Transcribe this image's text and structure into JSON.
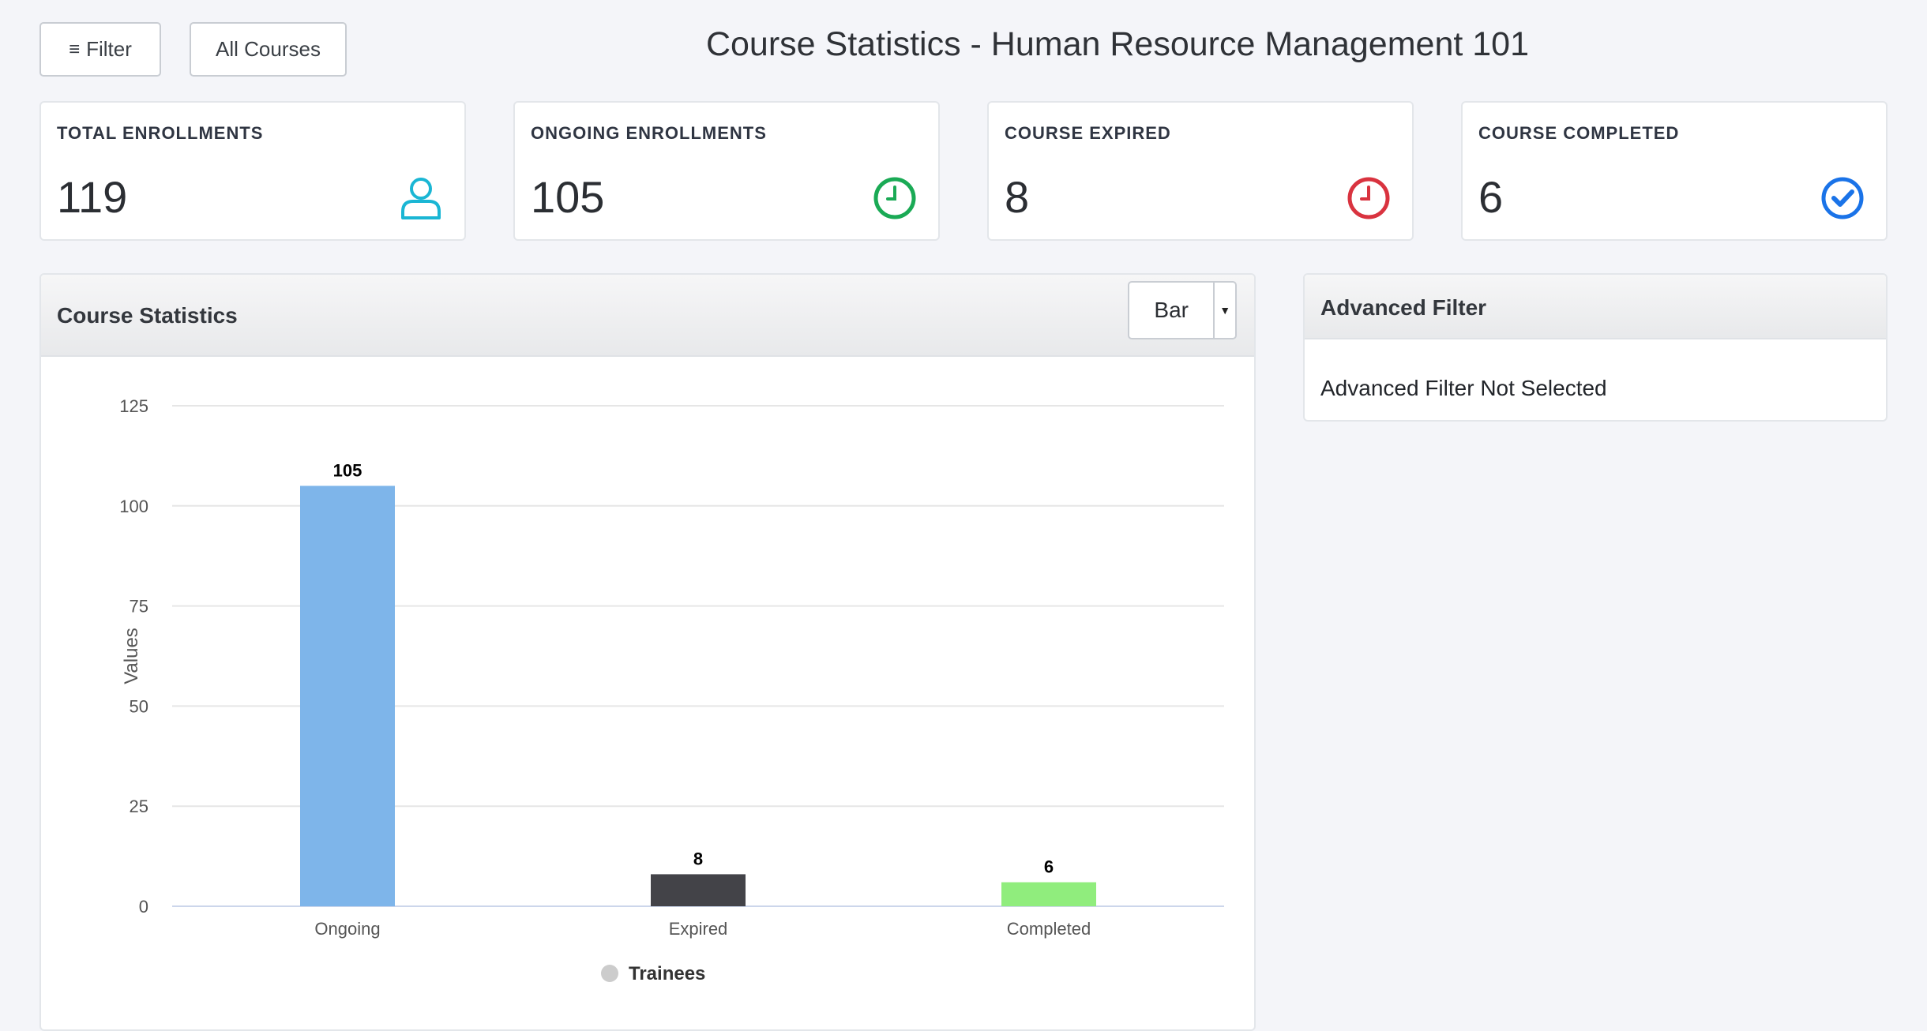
{
  "toolbar": {
    "filter_label": "Filter",
    "all_courses_label": "All Courses"
  },
  "page": {
    "title": "Course Statistics - Human Resource Management 101"
  },
  "stats": [
    {
      "label": "TOTAL ENROLLMENTS",
      "value": "119",
      "icon": "user-icon",
      "color": "#1ab6d4"
    },
    {
      "label": "ONGOING ENROLLMENTS",
      "value": "105",
      "icon": "clock-icon",
      "color": "#1aaa55"
    },
    {
      "label": "COURSE EXPIRED",
      "value": "8",
      "icon": "clock-icon",
      "color": "#d9333f"
    },
    {
      "label": "COURSE COMPLETED",
      "value": "6",
      "icon": "check-circle-icon",
      "color": "#1a73e8"
    }
  ],
  "chart_panel": {
    "title": "Course Statistics",
    "chart_type_selected": "Bar"
  },
  "filter_panel": {
    "title": "Advanced Filter",
    "message": "Advanced Filter Not Selected"
  },
  "chart_data": {
    "type": "bar",
    "categories": [
      "Ongoing",
      "Expired",
      "Completed"
    ],
    "series": [
      {
        "name": "Trainees",
        "values": [
          105,
          8,
          6
        ]
      }
    ],
    "bar_colors": [
      "#7eb5ea",
      "#434348",
      "#90ed7d"
    ],
    "ylabel": "Values",
    "ylim": [
      0,
      125
    ],
    "yticks": [
      0,
      25,
      50,
      75,
      100,
      125
    ],
    "grid": true,
    "data_labels": true,
    "legend": "bottom-center"
  }
}
